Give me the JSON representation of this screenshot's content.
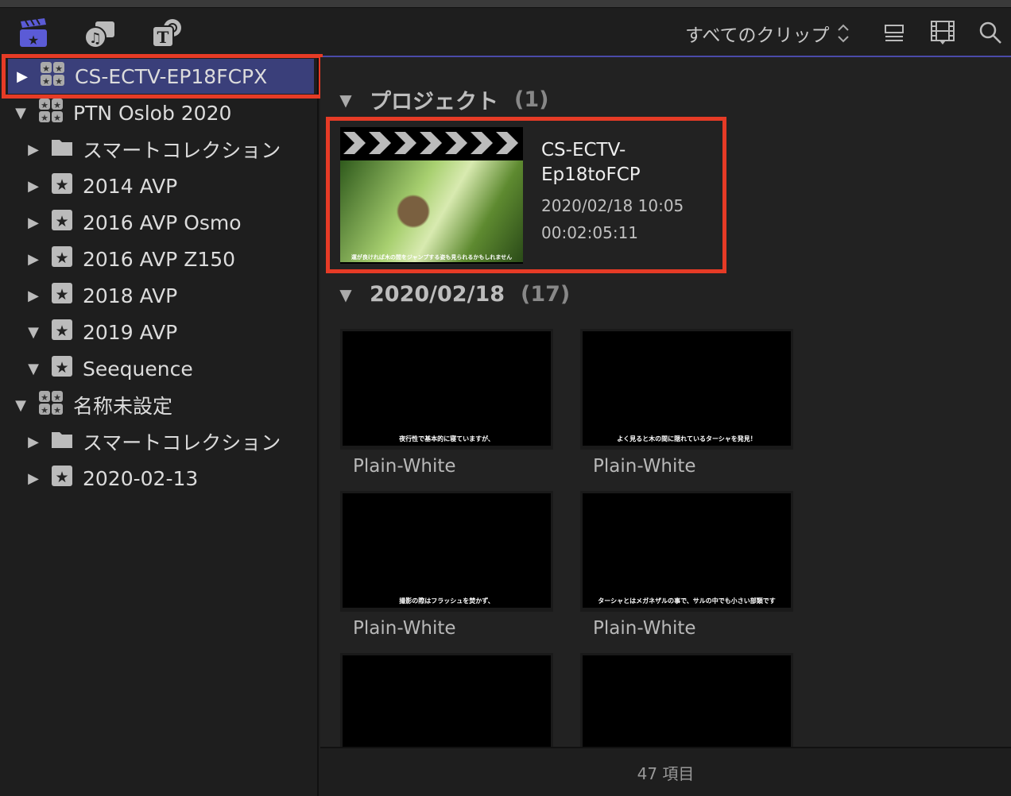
{
  "toolbar": {
    "filter_label": "すべてのクリップ",
    "icons": [
      "libraries-icon",
      "photos-audio-icon",
      "titles-generators-icon",
      "list-view-icon",
      "filmstrip-view-icon",
      "search-icon"
    ]
  },
  "sidebar": {
    "items": [
      {
        "label": "CS-ECTV-EP18FCPX",
        "type": "library",
        "expanded": false,
        "selected": true
      },
      {
        "label": "PTN Oslob 2020",
        "type": "library",
        "expanded": true
      },
      {
        "label": "スマートコレクション",
        "type": "folder",
        "expanded": false
      },
      {
        "label": "2014 AVP",
        "type": "event",
        "expanded": false
      },
      {
        "label": "2016 AVP Osmo",
        "type": "event",
        "expanded": false
      },
      {
        "label": "2016 AVP Z150",
        "type": "event",
        "expanded": false
      },
      {
        "label": "2018 AVP",
        "type": "event",
        "expanded": false
      },
      {
        "label": "2019 AVP",
        "type": "event",
        "expanded": true
      },
      {
        "label": "Seequence",
        "type": "event",
        "expanded": true
      },
      {
        "label": "名称未設定",
        "type": "library",
        "expanded": true
      },
      {
        "label": "スマートコレクション",
        "type": "folder",
        "expanded": false
      },
      {
        "label": "2020-02-13",
        "type": "event",
        "expanded": false
      }
    ]
  },
  "main": {
    "project_section": {
      "title": "プロジェクト",
      "count": "(1)"
    },
    "project": {
      "name_line1": "CS-ECTV-",
      "name_line2": "Ep18toFCP",
      "date": "2020/02/18 10:05",
      "duration": "00:02:05:11",
      "subtitle": "運が良ければ木の間をジャンプする姿も見られるかもしれません"
    },
    "date_section": {
      "title": "2020/02/18",
      "count": "(17)"
    },
    "clips": [
      {
        "label": "Plain-White",
        "subtitle": "夜行性で基本的に寝ていますが、"
      },
      {
        "label": "Plain-White",
        "subtitle": "よく見ると木の間に隠れているターシャを発見！"
      },
      {
        "label": "Plain-White",
        "subtitle": "撮影の際はフラッシュを焚かず、"
      },
      {
        "label": "Plain-White",
        "subtitle": "ターシャとはメガネザルの事で、サルの中でも小さい部類です"
      },
      {
        "label": "",
        "subtitle": ""
      },
      {
        "label": "",
        "subtitle": ""
      }
    ]
  },
  "footer": {
    "count": "47 項目"
  },
  "colors": {
    "selection": "#3a3f7a",
    "highlight": "#e63b26",
    "accent": "#5b5bd6"
  }
}
